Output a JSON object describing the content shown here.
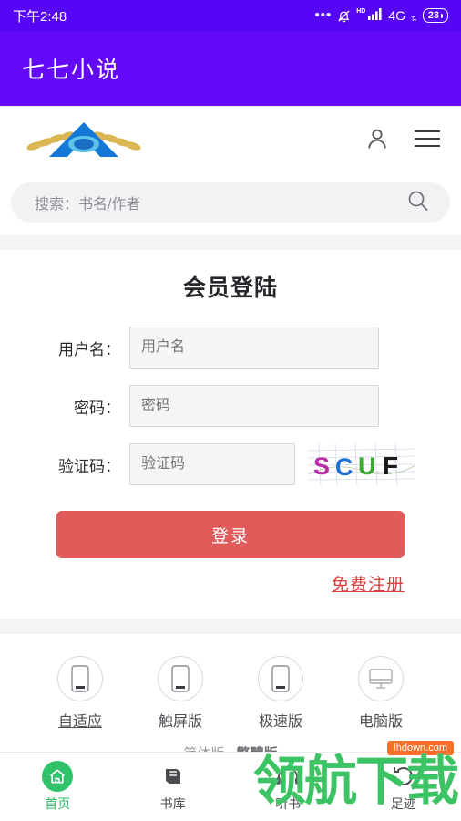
{
  "statusbar": {
    "time": "下午2:48",
    "dots": "•••",
    "hd": "HD",
    "network": "4G",
    "it": "⇅",
    "battery": "23",
    "bell_icon": "bell-muted-icon",
    "signal_icon": "signal-bars-icon"
  },
  "appbar": {
    "title": "七七小说"
  },
  "header": {
    "logo_alt": "site-logo",
    "account_icon": "person-icon",
    "menu_icon": "hamburger-menu-icon"
  },
  "search": {
    "placeholder": "搜索：书名/作者",
    "value": "",
    "icon": "search-icon"
  },
  "login": {
    "title": "会员登陆",
    "fields": [
      {
        "label": "用户名：",
        "placeholder": "用户名",
        "value": "",
        "name": "username"
      },
      {
        "label": "密码：",
        "placeholder": "密码",
        "value": "",
        "name": "password"
      },
      {
        "label": "验证码：",
        "placeholder": "验证码",
        "value": "",
        "name": "captcha"
      }
    ],
    "captcha_text": "SCUF",
    "captcha_colors": [
      "#b92ea8",
      "#1f6fd0",
      "#3aa832",
      "#1a1a1a"
    ],
    "submit_label": "登录",
    "register_label": "免费注册",
    "submit_color": "#e15b5b",
    "register_color": "#d9413f"
  },
  "versions": [
    {
      "label": "自适应",
      "icon": "phone-icon",
      "active": true
    },
    {
      "label": "触屏版",
      "icon": "phone-icon",
      "active": false
    },
    {
      "label": "极速版",
      "icon": "phone-icon",
      "active": false
    },
    {
      "label": "电脑版",
      "icon": "desktop-icon",
      "active": false
    }
  ],
  "languages": {
    "simplified": "简体版",
    "separator": "·",
    "traditional": "繁體版"
  },
  "bottomnav": [
    {
      "label": "首页",
      "icon": "home-icon",
      "active": true
    },
    {
      "label": "书库",
      "icon": "book-icon",
      "active": false
    },
    {
      "label": "听书",
      "icon": "headphones-icon",
      "active": false
    },
    {
      "label": "足迹",
      "icon": "history-icon",
      "active": false
    }
  ],
  "watermark": {
    "text": "领航下载",
    "badge": "lhdown.com",
    "color": "#3cc464",
    "badge_color": "#f4712a"
  }
}
